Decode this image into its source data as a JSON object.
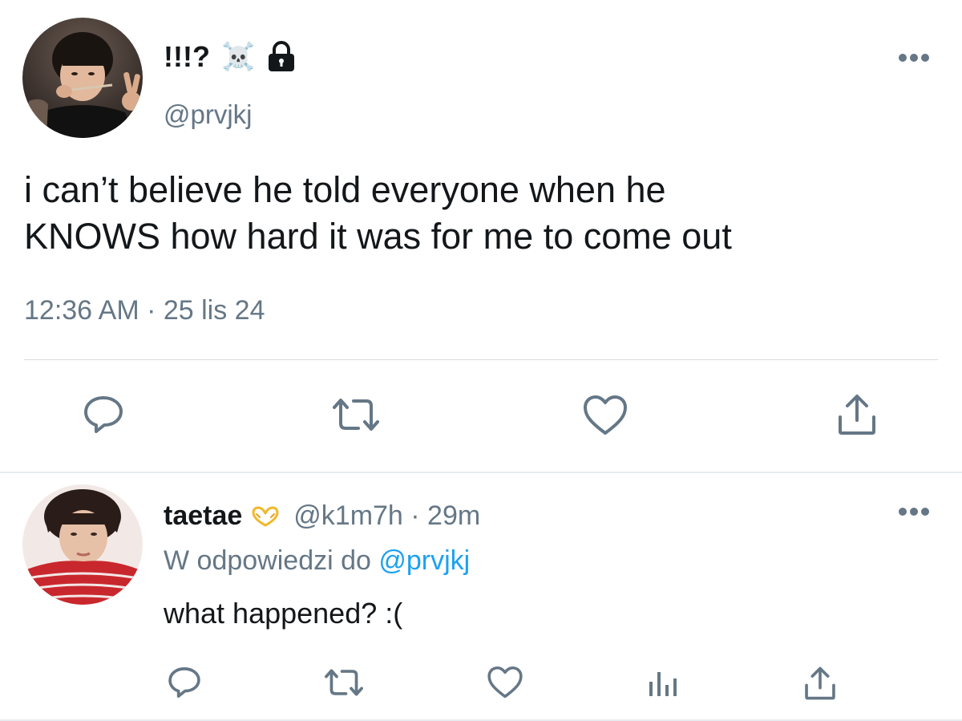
{
  "main_tweet": {
    "display_name": "!!!?",
    "name_icons": [
      "skull-crossbones-icon",
      "lock-icon"
    ],
    "handle": "@prvjkj",
    "text": "i can’t believe he told everyone when he\nKNOWS how hard it was for me to come out",
    "timestamp": "12:36 AM · 25 lis 24",
    "actions": [
      "reply-icon",
      "retweet-icon",
      "like-icon",
      "share-icon"
    ]
  },
  "reply": {
    "display_name": "taetae",
    "name_emoji": "heart-hands-icon",
    "handle_time": "@k1m7h · 29m",
    "reply_to_prefix": "W odpowiedzi do ",
    "reply_to_handle": "@prvjkj",
    "text": "what happened? :(",
    "actions": [
      "reply-icon",
      "retweet-icon",
      "like-icon",
      "analytics-icon",
      "share-icon"
    ]
  },
  "colors": {
    "text": "#14171a",
    "secondary": "#657786",
    "link": "#1da1f2",
    "divider": "#e6ecf0"
  }
}
